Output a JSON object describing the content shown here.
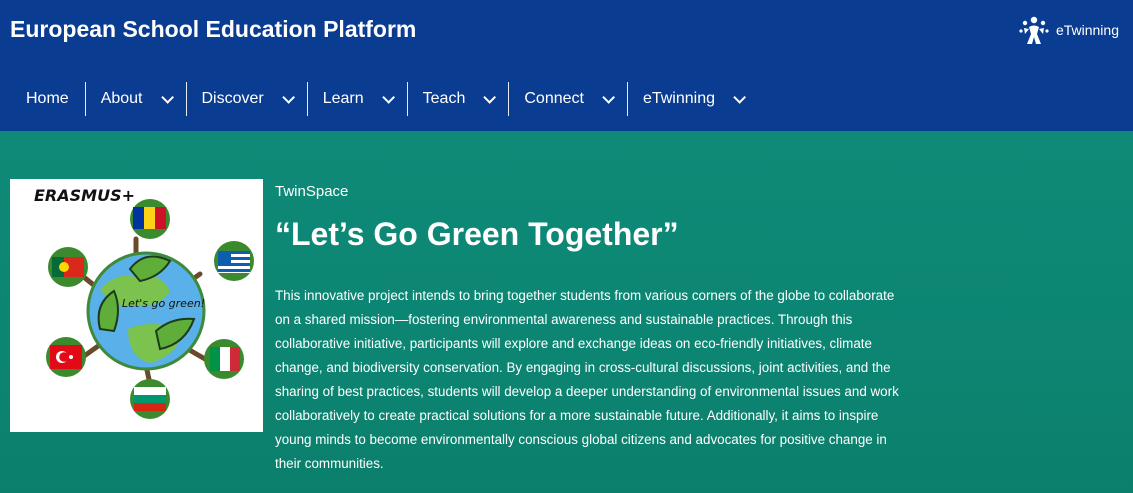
{
  "header": {
    "site_title": "European School Education Platform",
    "brand_label": "eTwinning",
    "background": "#0a3d91"
  },
  "nav": {
    "items": [
      {
        "label": "Home",
        "has_dropdown": false
      },
      {
        "label": "About",
        "has_dropdown": true
      },
      {
        "label": "Discover",
        "has_dropdown": true
      },
      {
        "label": "Learn",
        "has_dropdown": true
      },
      {
        "label": "Teach",
        "has_dropdown": true
      },
      {
        "label": "Connect",
        "has_dropdown": true
      },
      {
        "label": "eTwinning",
        "has_dropdown": true
      }
    ]
  },
  "project": {
    "kicker": "TwinSpace",
    "title": "“Let’s Go Green Together”",
    "description": "This innovative project intends to bring together students from various corners of the globe to collaborate on a shared mission—fostering environmental awareness and sustainable practices. Through this collaborative initiative, participants will explore and exchange ideas on eco-friendly initiatives, climate change, and biodiversity conservation. By engaging in cross-cultural discussions, joint activities, and the sharing of best practices, students will develop a deeper understanding of environmental issues and work collaboratively to create practical solutions for a more sustainable future. Additionally, it aims to inspire young minds to become environmentally conscious global citizens and advocates for positive change in their communities.",
    "logo": {
      "heading": "ERASMUS+",
      "globe_text": "Let's go green!"
    }
  },
  "colors": {
    "hero": "#0d8a78",
    "text": "#ffffff"
  }
}
